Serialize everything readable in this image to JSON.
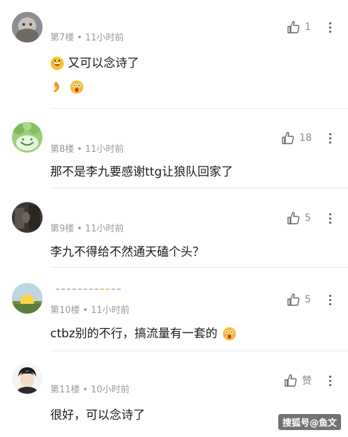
{
  "comments": [
    {
      "floor": "第7楼",
      "time": "11小时前",
      "likes": "1",
      "text": "又可以念诗了",
      "avatar": "stone-statue-avatar",
      "emojis": [
        "grin-emoji",
        "flame-emoji",
        "surprised-emoji"
      ]
    },
    {
      "floor": "第8楼",
      "time": "11小时前",
      "likes": "18",
      "text": "那不是李九要感谢ttg让狼队回家了",
      "avatar": "green-smile-avatar"
    },
    {
      "floor": "第9楼",
      "time": "11小时前",
      "likes": "5",
      "text": "李九不得给不然通天磕个头？",
      "avatar": "dark-photo-avatar"
    },
    {
      "floor": "第10楼",
      "time": "11小时前",
      "likes": "5",
      "text": "ctbz别的不行，搞流量有一套的",
      "avatar": "sunrise-avatar",
      "emojis": [
        "surprised-emoji"
      ]
    },
    {
      "floor": "第11楼",
      "time": "10小时前",
      "likes": "赞",
      "text": "很好，可以念诗了",
      "avatar": "portrait-avatar"
    }
  ],
  "watermark": "搜狐号@鱼文",
  "colors": {
    "meta": "#9a9a9a",
    "text": "#1a1a1a",
    "divider": "#e8e8e8"
  }
}
